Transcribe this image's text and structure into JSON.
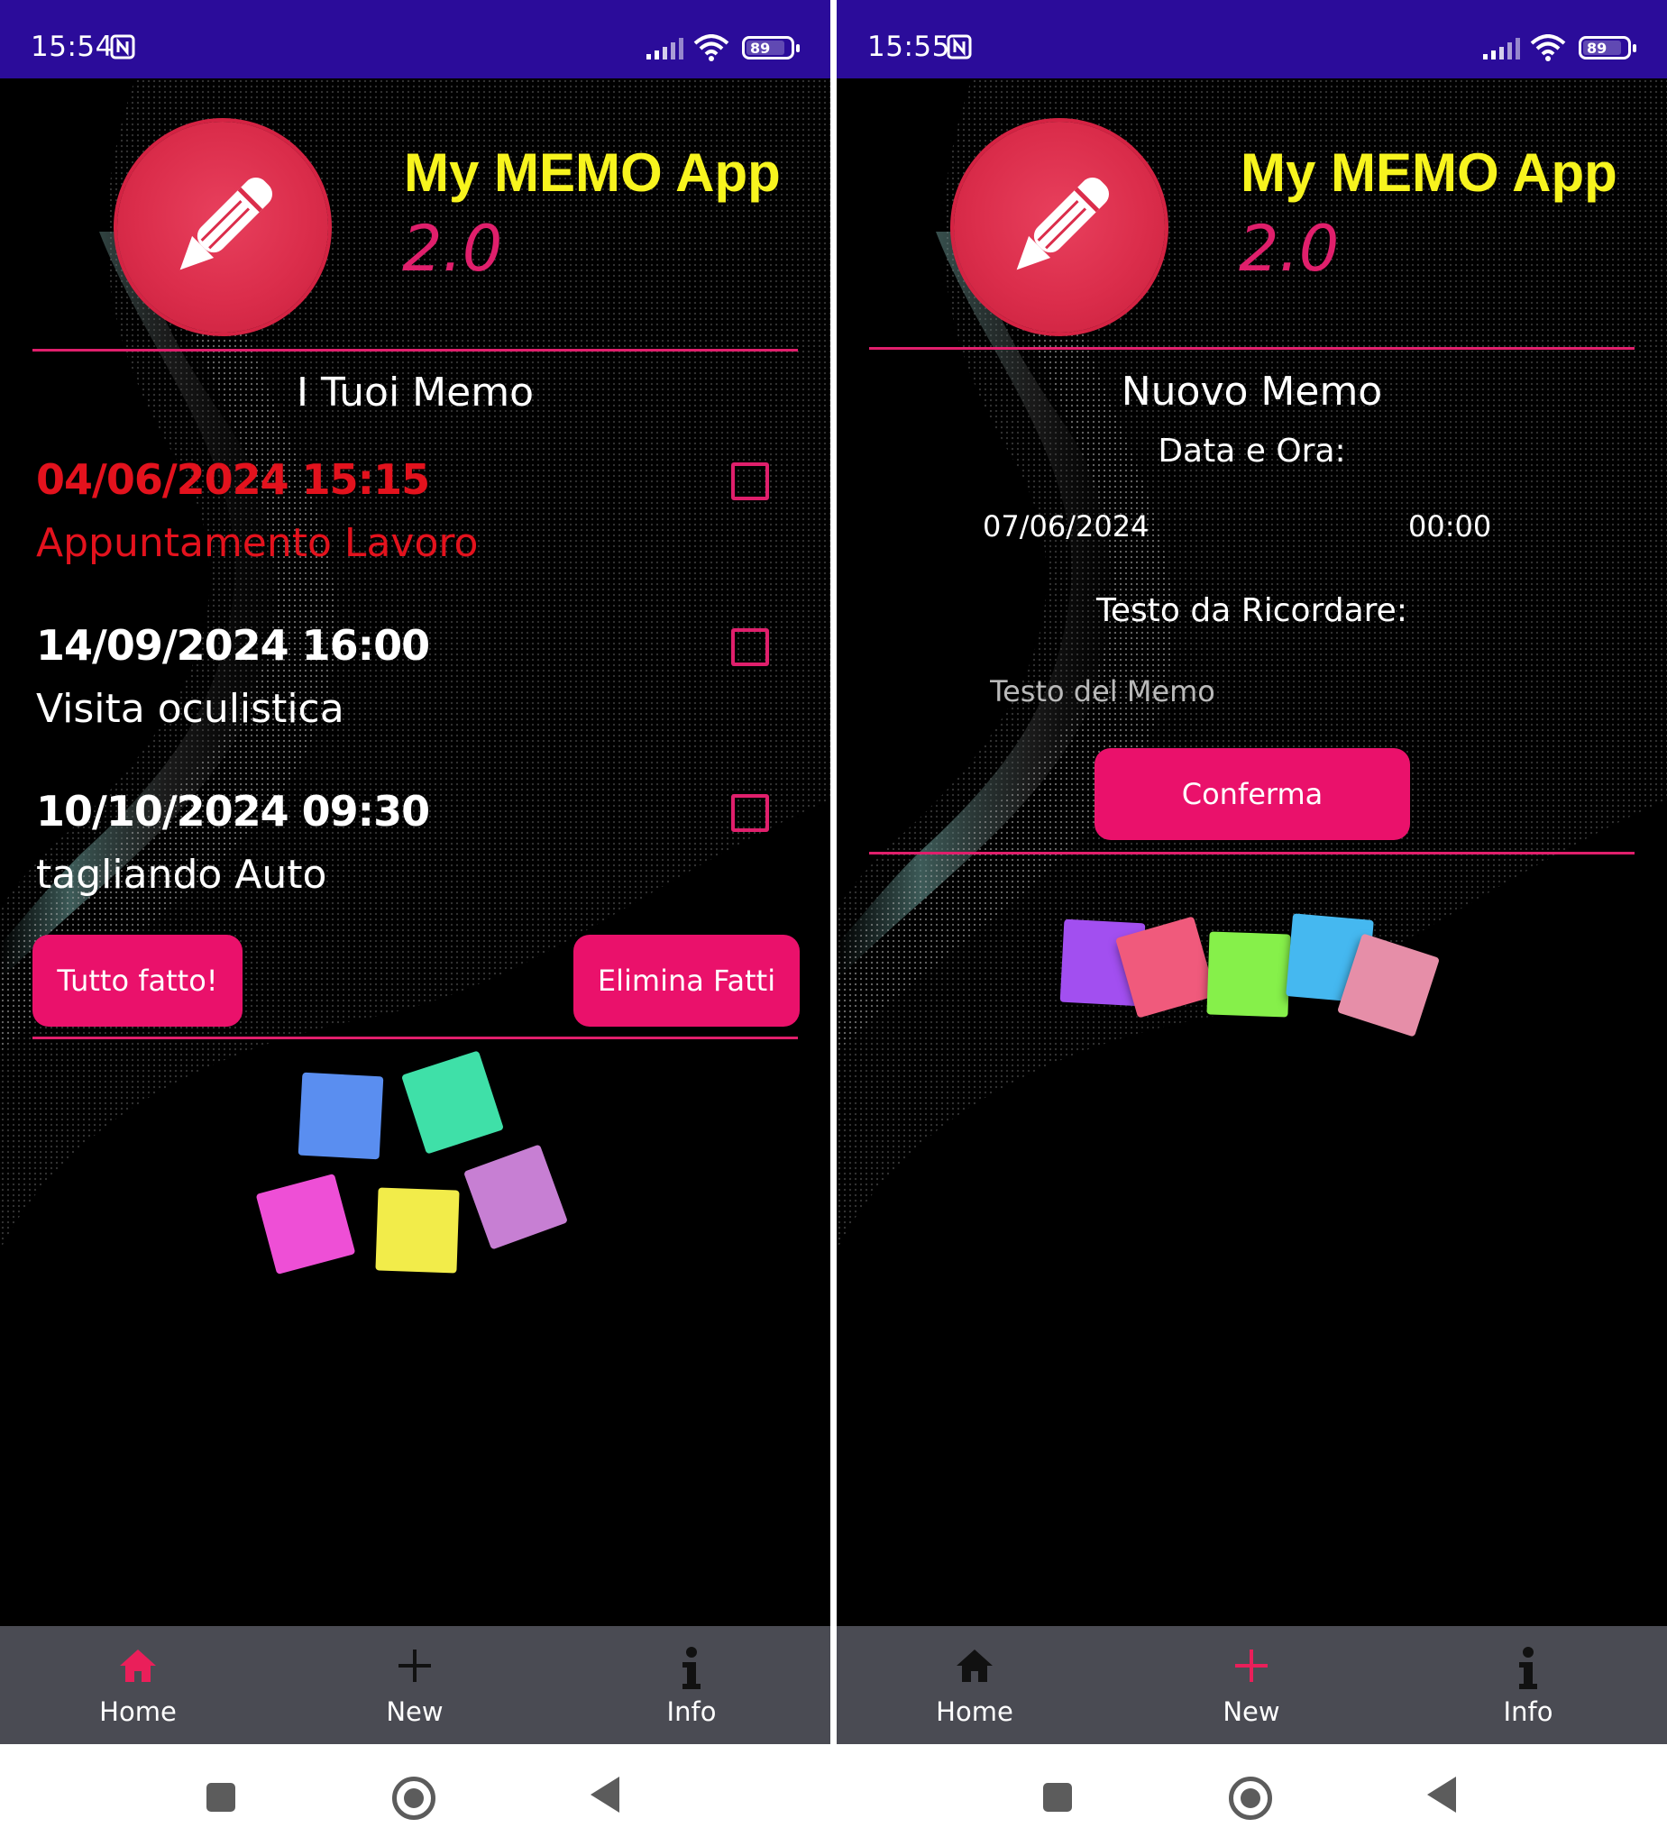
{
  "screens": {
    "left": {
      "status": {
        "time": "15:54",
        "battery": "89",
        "battery_percent": 89
      },
      "app": {
        "title": "My MEMO App",
        "version": "2.0"
      },
      "section_title": "I Tuoi Memo",
      "memos": [
        {
          "date": "04/06/2024 15:15",
          "text": "Appuntamento Lavoro",
          "overdue": true,
          "checked": false
        },
        {
          "date": "14/09/2024 16:00",
          "text": "Visita oculistica",
          "overdue": false,
          "checked": false
        },
        {
          "date": "10/10/2024 09:30",
          "text": "tagliando Auto",
          "overdue": false,
          "checked": false
        }
      ],
      "buttons": {
        "all_done": "Tutto fatto!",
        "delete_done": "Elimina Fatti"
      },
      "nav": {
        "home": "Home",
        "new": "New",
        "info": "Info",
        "active": "home"
      }
    },
    "right": {
      "status": {
        "time": "15:55",
        "battery": "89",
        "battery_percent": 89
      },
      "app": {
        "title": "My MEMO App",
        "version": "2.0"
      },
      "section_title": "Nuovo Memo",
      "form": {
        "datetime_label": "Data e Ora:",
        "date_value": "07/06/2024",
        "time_value": "00:00",
        "text_label": "Testo da Ricordare:",
        "text_placeholder": "Testo del Memo",
        "confirm_label": "Conferma"
      },
      "nav": {
        "home": "Home",
        "new": "New",
        "info": "Info",
        "active": "new"
      }
    }
  },
  "icons": {
    "status": [
      "nfc-icon",
      "signal-icon",
      "wifi-icon",
      "battery-icon"
    ],
    "logo": "pencil-icon",
    "nav": [
      "home-icon",
      "plus-icon",
      "info-icon"
    ],
    "system": [
      "recents-square-icon",
      "home-circle-icon",
      "back-triangle-icon"
    ]
  },
  "colors": {
    "status_bar": "#2b0c9a",
    "background": "#000000",
    "accent_pink": "#ea116b",
    "title_yellow": "#f7f41e",
    "overdue_red": "#e3121d",
    "logo_red": "#db2d4b",
    "nav_bar": "#4a4b53",
    "sticky_notes_left": [
      "#5a8ef0",
      "#3fe0a8",
      "#ee4fd6",
      "#f2ec4a",
      "#c77fd3"
    ],
    "sticky_notes_right": [
      "#a24ff0",
      "#f05a7c",
      "#86f04a",
      "#45b8f0",
      "#e68ea8"
    ]
  }
}
